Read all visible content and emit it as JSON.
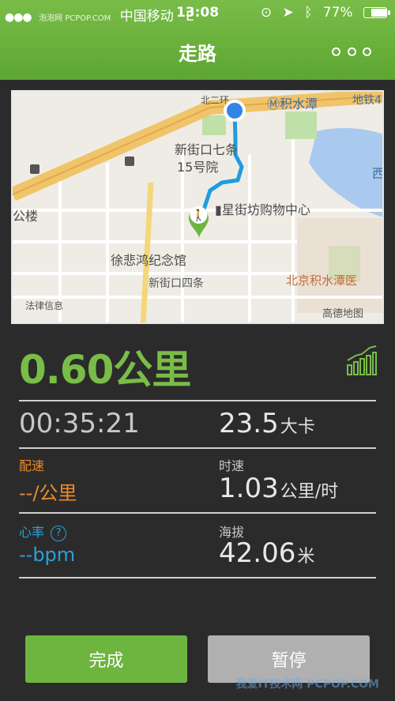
{
  "status_bar": {
    "watermark": "泡泡网 PCPOP.COM",
    "carrier": "中国移动",
    "network": "E",
    "time": "13:08",
    "battery": "77%",
    "battery_level": 0.77
  },
  "header": {
    "title": "走路"
  },
  "map": {
    "labels": {
      "road_north": "北二环",
      "station": "积水潭",
      "subway": "地铁4",
      "block_a": "新街口七条",
      "block_b": "15号院",
      "mall": "星街坊购物中心",
      "park": "公楼",
      "xi": "西",
      "museum": "徐悲鸿纪念馆",
      "street": "新街口四条",
      "hospital": "北京积水潭医",
      "legal": "法律信息",
      "brand": "高德地图"
    }
  },
  "summary": {
    "distance": "0.60公里"
  },
  "stats": {
    "duration": "00:35:21",
    "calories_value": "23.5",
    "calories_unit": "大卡",
    "pace_label": "配速",
    "pace_value": "--",
    "pace_unit": "/公里",
    "speed_label": "时速",
    "speed_value": "1.03",
    "speed_unit": "公里/时",
    "heart_label": "心率",
    "heart_help": "?",
    "heart_value": "--bpm",
    "altitude_label": "海拔",
    "altitude_value": "42.06",
    "altitude_unit": "米"
  },
  "buttons": {
    "finish": "完成",
    "pause": "暂停"
  },
  "watermark_bottom": "我爱IT技术网 PCPOP.COM",
  "colors": {
    "accent_green": "#79bd48",
    "pace_orange": "#e98a2e",
    "heart_blue": "#2aa0d8",
    "route_blue": "#1e9de0"
  }
}
